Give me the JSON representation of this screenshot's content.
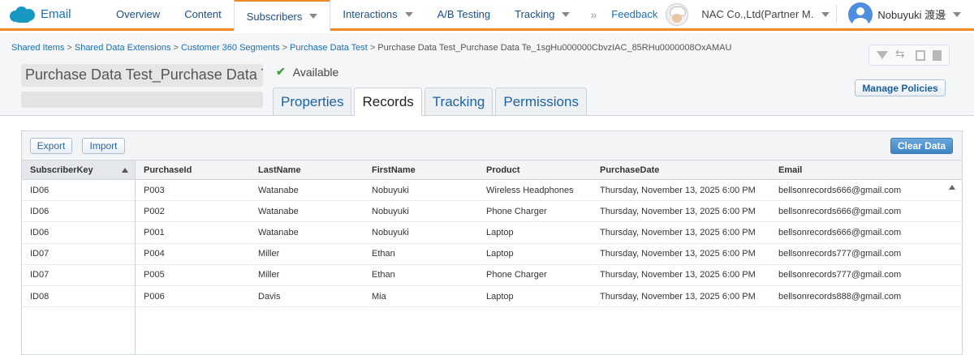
{
  "nav": {
    "brand": "Email",
    "items": [
      {
        "label": "Overview",
        "caret": false
      },
      {
        "label": "Content",
        "caret": false
      },
      {
        "label": "Subscribers",
        "caret": true
      },
      {
        "label": "Interactions",
        "caret": true
      },
      {
        "label": "A/B Testing",
        "caret": false
      },
      {
        "label": "Tracking",
        "caret": true
      }
    ],
    "more": "»",
    "feedback": "Feedback",
    "account": "NAC Co.,Ltd(Partner M...",
    "user": "Nobuyuki 渡邊"
  },
  "breadcrumb": {
    "links": [
      "Shared Items",
      "Shared Data Extensions",
      "Customer 360 Segments",
      "Purchase Data Test"
    ],
    "separator": ">",
    "current": "Purchase Data Test_Purchase Data Te_1sgHu000000CbvzIAC_85RHu0000008OxAMAU"
  },
  "header": {
    "title": "Purchase Data Test_Purchase Data T",
    "status": "Available",
    "manage_policies": "Manage Policies"
  },
  "tabs": [
    "Properties",
    "Records",
    "Tracking",
    "Permissions"
  ],
  "grid": {
    "export_label": "Export",
    "import_label": "Import",
    "clear_label": "Clear Data",
    "frozen_header": "SubscriberKey",
    "columns": [
      "PurchaseId",
      "LastName",
      "FirstName",
      "Product",
      "PurchaseDate",
      "Email"
    ],
    "rows": [
      {
        "key": "ID06",
        "cells": [
          "P003",
          "Watanabe",
          "Nobuyuki",
          "Wireless Headphones",
          "Thursday, November 13, 2025 6:00 PM",
          "bellsonrecords666@gmail.com"
        ]
      },
      {
        "key": "ID06",
        "cells": [
          "P002",
          "Watanabe",
          "Nobuyuki",
          "Phone Charger",
          "Thursday, November 13, 2025 6:00 PM",
          "bellsonrecords666@gmail.com"
        ]
      },
      {
        "key": "ID06",
        "cells": [
          "P001",
          "Watanabe",
          "Nobuyuki",
          "Laptop",
          "Thursday, November 13, 2025 6:00 PM",
          "bellsonrecords666@gmail.com"
        ]
      },
      {
        "key": "ID07",
        "cells": [
          "P004",
          "Miller",
          "Ethan",
          "Laptop",
          "Thursday, November 13, 2025 6:00 PM",
          "bellsonrecords777@gmail.com"
        ]
      },
      {
        "key": "ID07",
        "cells": [
          "P005",
          "Miller",
          "Ethan",
          "Phone Charger",
          "Thursday, November 13, 2025 6:00 PM",
          "bellsonrecords777@gmail.com"
        ]
      },
      {
        "key": "ID08",
        "cells": [
          "P006",
          "Davis",
          "Mia",
          "Laptop",
          "Thursday, November 13, 2025 6:00 PM",
          "bellsonrecords888@gmail.com"
        ]
      }
    ]
  },
  "colors": {
    "accent": "#f08a24",
    "link": "#1a6fb5",
    "primary_button": "#3f84c7"
  }
}
